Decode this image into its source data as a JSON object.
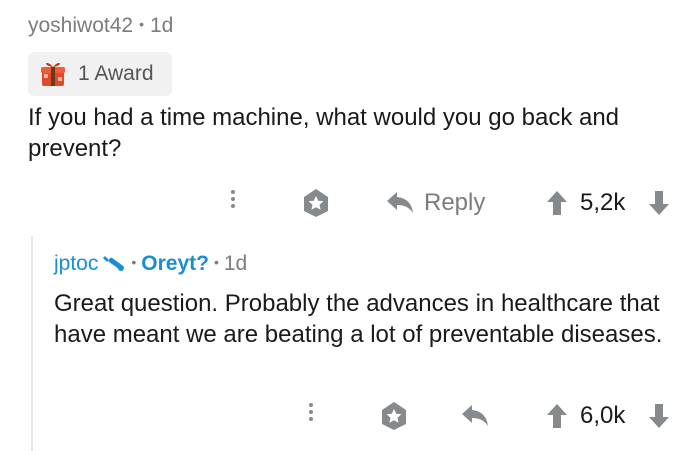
{
  "comment": {
    "username": "yoshiwot42",
    "separator": "•",
    "age": "1d",
    "award_label": "1 Award",
    "body": "If you had a time machine, what would you go back and prevent?",
    "actions": {
      "reply_label": "Reply",
      "score": "5,2k"
    }
  },
  "reply": {
    "username": "jptoc",
    "separator": "•",
    "flair": "Oreyt?",
    "separator2": "•",
    "age": "1d",
    "body": "Great question. Probably the advances in healthcare that have meant we are beating a lot of preventable diseases.",
    "actions": {
      "score": "6,0k"
    }
  },
  "icons": {
    "award": "gift-award-icon",
    "more": "more-options-icon",
    "save": "save-star-icon",
    "reply": "reply-arrow-icon",
    "upvote": "upvote-arrow-icon",
    "downvote": "downvote-arrow-icon",
    "mod": "wrench-mod-icon"
  },
  "colors": {
    "username_gray": "#7c7c7c",
    "link_blue": "#1a8ed1",
    "icon_gray": "#878a8c",
    "text": "#1a1a1b",
    "pill_bg": "#f1f1f1"
  }
}
